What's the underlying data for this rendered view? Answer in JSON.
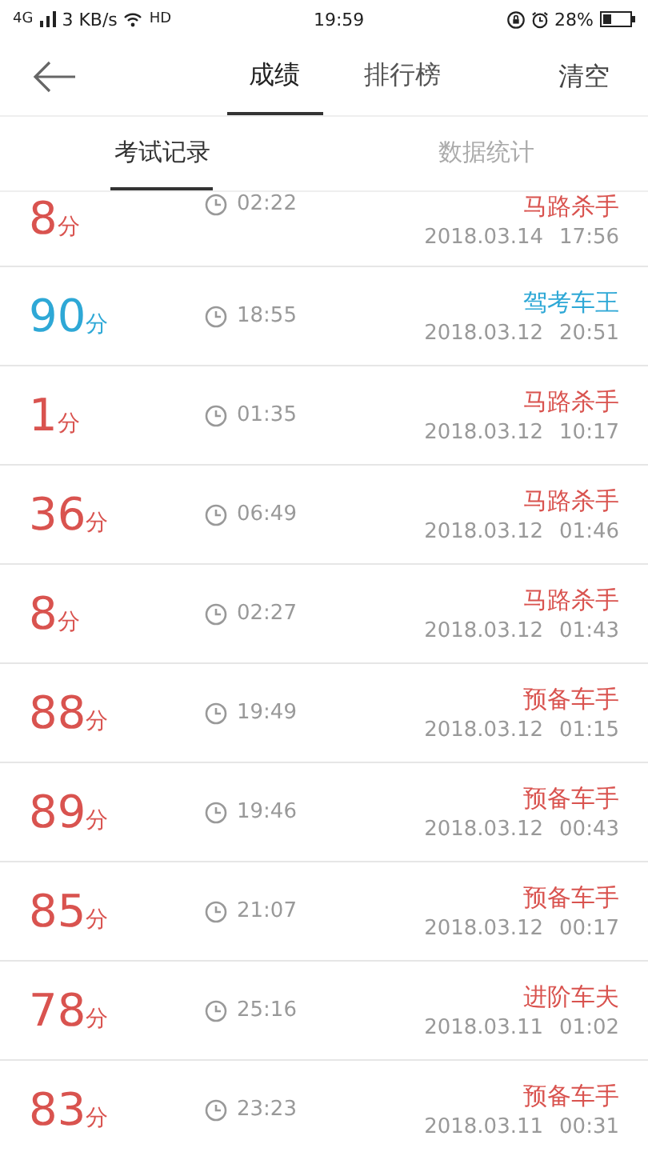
{
  "status_bar": {
    "network": "4G",
    "speed": "3 KB/s",
    "call": "HD",
    "time": "19:59",
    "battery": "28%"
  },
  "header": {
    "tabs": [
      {
        "label": "成绩",
        "selected": true
      },
      {
        "label": "排行榜",
        "selected": false
      }
    ],
    "action": "清空"
  },
  "subtabs": [
    {
      "label": "考试记录",
      "selected": true
    },
    {
      "label": "数据统计",
      "selected": false
    }
  ],
  "records": [
    {
      "score": "8",
      "unit": "分",
      "duration": "02:22",
      "title": "马路杀手",
      "date": "2018.03.14",
      "time": "17:56",
      "color": "#d9534f"
    },
    {
      "score": "90",
      "unit": "分",
      "duration": "18:55",
      "title": "驾考车王",
      "date": "2018.03.12",
      "time": "20:51",
      "color": "#2ea8d6"
    },
    {
      "score": "1",
      "unit": "分",
      "duration": "01:35",
      "title": "马路杀手",
      "date": "2018.03.12",
      "time": "10:17",
      "color": "#d9534f"
    },
    {
      "score": "36",
      "unit": "分",
      "duration": "06:49",
      "title": "马路杀手",
      "date": "2018.03.12",
      "time": "01:46",
      "color": "#d9534f"
    },
    {
      "score": "8",
      "unit": "分",
      "duration": "02:27",
      "title": "马路杀手",
      "date": "2018.03.12",
      "time": "01:43",
      "color": "#d9534f"
    },
    {
      "score": "88",
      "unit": "分",
      "duration": "19:49",
      "title": "预备车手",
      "date": "2018.03.12",
      "time": "01:15",
      "color": "#d9534f"
    },
    {
      "score": "89",
      "unit": "分",
      "duration": "19:46",
      "title": "预备车手",
      "date": "2018.03.12",
      "time": "00:43",
      "color": "#d9534f"
    },
    {
      "score": "85",
      "unit": "分",
      "duration": "21:07",
      "title": "预备车手",
      "date": "2018.03.12",
      "time": "00:17",
      "color": "#d9534f"
    },
    {
      "score": "78",
      "unit": "分",
      "duration": "25:16",
      "title": "进阶车夫",
      "date": "2018.03.11",
      "time": "01:02",
      "color": "#d9534f"
    },
    {
      "score": "83",
      "unit": "分",
      "duration": "23:23",
      "title": "预备车手",
      "date": "2018.03.11",
      "time": "00:31",
      "color": "#d9534f"
    }
  ]
}
